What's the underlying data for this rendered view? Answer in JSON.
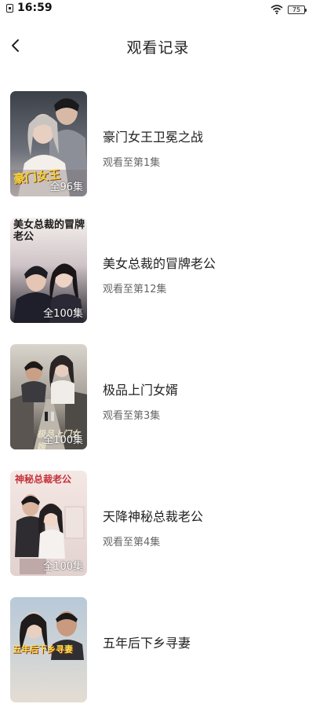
{
  "status_bar": {
    "time": "16:59",
    "battery": "75",
    "icons": [
      "sim-icon",
      "wifi-icon",
      "battery-icon"
    ]
  },
  "header": {
    "back_icon": "chevron-left-icon",
    "title": "观看记录"
  },
  "history": [
    {
      "title": "豪门女王卫冕之战",
      "progress": "观看至第1集",
      "episodes": "全96集",
      "cover_text": "豪门女王"
    },
    {
      "title": "美女总裁的冒牌老公",
      "progress": "观看至第12集",
      "episodes": "全100集",
      "cover_text": "美女总裁的冒牌老公"
    },
    {
      "title": "极品上门女婿",
      "progress": "观看至第3集",
      "episodes": "全100集",
      "cover_text": "极品上门女婿"
    },
    {
      "title": "天降神秘总裁老公",
      "progress": "观看至第4集",
      "episodes": "全100集",
      "cover_text": "神秘总裁老公"
    },
    {
      "title": "五年后下乡寻妻",
      "progress": "",
      "episodes": "",
      "cover_text": "五年后下乡寻妻"
    }
  ]
}
